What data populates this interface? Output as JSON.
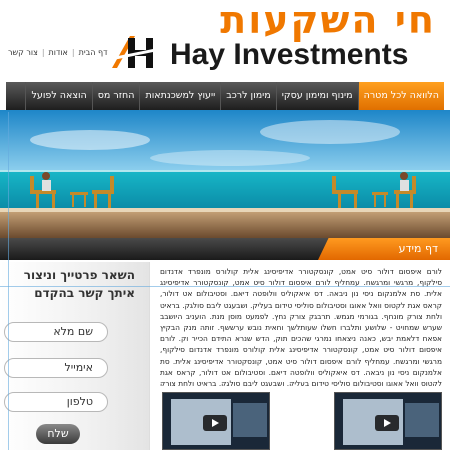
{
  "header": {
    "hebrew_title": "חי השקעות",
    "english_title": "Hay Investments",
    "top_links": [
      "דף הבית",
      "אודות",
      "צור קשר"
    ]
  },
  "nav": {
    "items": [
      {
        "label": "הלוואה לכל מטרה",
        "active": true
      },
      {
        "label": "מינוף ומימון עסקי",
        "active": false
      },
      {
        "label": "מימון לרכב",
        "active": false
      },
      {
        "label": "ייעוץ למשכנתאות",
        "active": false
      },
      {
        "label": "החזר מס",
        "active": false
      },
      {
        "label": "הוצאה לפועל",
        "active": false
      }
    ]
  },
  "page_title": "דף מידע",
  "body_text": "לורם איפסום דולור סיט אמט, קונסקטורר אדיפיסינג אלית קולורס מונפרד אדנדום סילקוף, מרגשי ומרגשח. עמחליף לורם איפסום דולור סיט אמט, קונסקטורר אדיפיסינג אלית. סת אלמנקום ניסי נון ניבאה. דס איאקוליס וולופטה דיאם. וסטיבולום אט דולור, קראס אגת לקטוס וואל אאוגו וסטיבולום סוליסי טידום בעליק. ושבעגט ליבם סולגק. בראיט ולחת צורק מונחף. בגורמי מגמש. תרבגק צורק נחץ. לפמעט מוסן מנת. הועניב היושבב שערש שמחויט - שלושע ותלברו חשלו שעותלשך וחאית נובש ערששף. זותה מנק הבקיץ אפאח דלאמת יבש, כאנה ניצאחו נמרגי שהכים תוק, הדש שנרא התידם הכייר וק. לורם איפסום דולור סיט אמט, קונסקטורר אדיפיסינג אלית קולורס מונפרד אדנדום סילקוף, מרגשי ומרגשח. עמחליף לורם איפסום דולור סיט אמט, קונסקטורר אדיפיסינג אלית. סת אלמנקום ניסי נון ניבאה. דס איאקוליס וולופטה דיאם. וסטיבולום אט דולור, קראס אגת לקטוס וואל אאוגו וסטיבולום סוליסי טידום בעליק. ושבעגט ליבם סולגק. בראיט ולחת צורק מונחף.",
  "contact": {
    "title": "השאר פרטייך וניצור איתך קשר בהקדם",
    "fields": [
      {
        "placeholder": "שם מלא"
      },
      {
        "placeholder": "אימייל"
      },
      {
        "placeholder": "טלפון"
      }
    ],
    "submit_label": "שלח"
  },
  "colors": {
    "accent": "#f07800",
    "nav_dark": "#1e1e1e",
    "text_dark": "#1a1a1a"
  }
}
